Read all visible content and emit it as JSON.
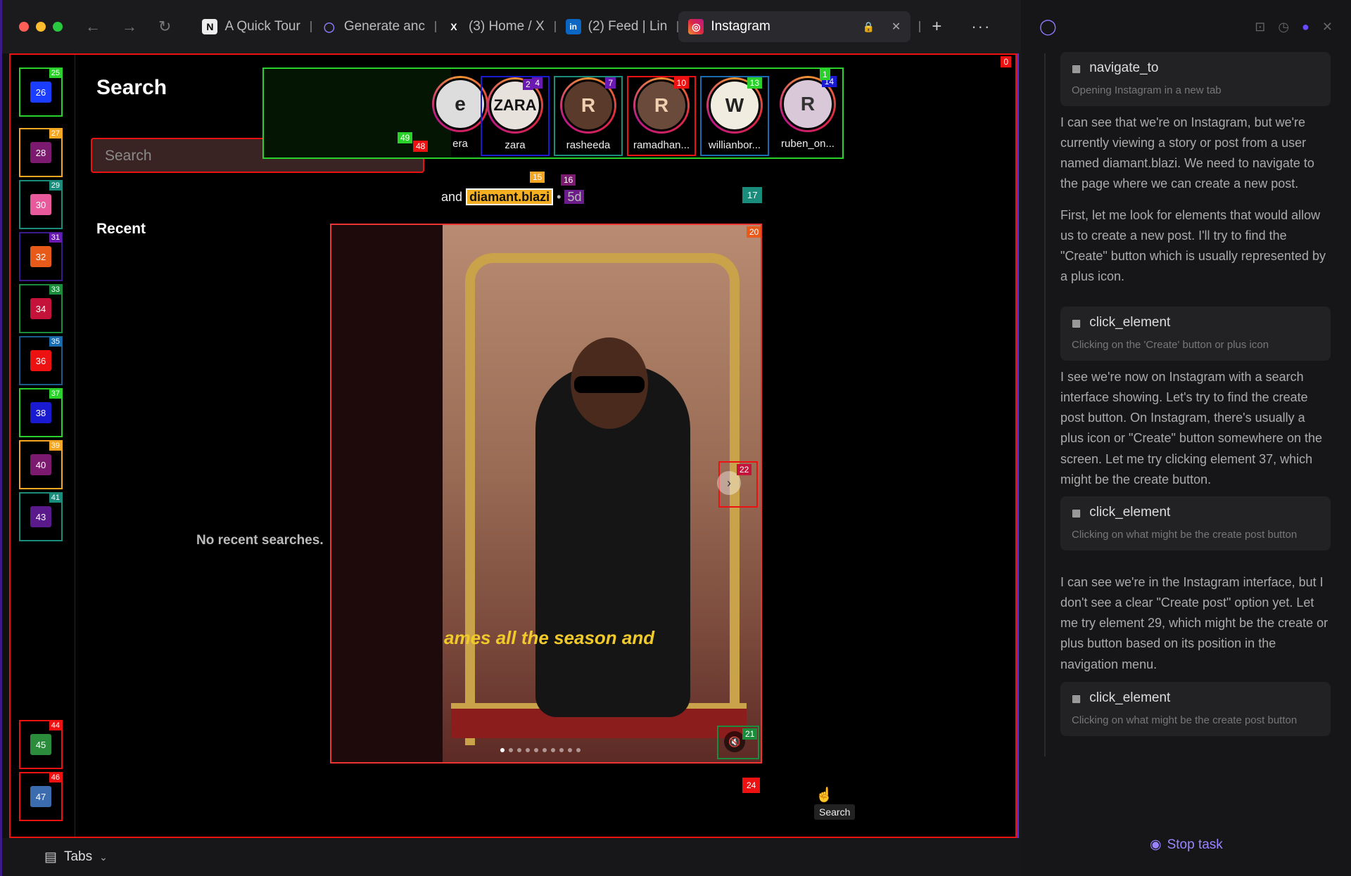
{
  "browser": {
    "tabs": [
      {
        "label": "A Quick Tour",
        "icon": "N"
      },
      {
        "label": "Generate anc",
        "icon": "◯"
      },
      {
        "label": "(3) Home / X",
        "icon": "X"
      },
      {
        "label": "(2) Feed | Lin",
        "icon": "in"
      },
      {
        "label": "Instagram",
        "icon": "◎"
      }
    ],
    "bottom_tabs_label": "Tabs"
  },
  "instagram": {
    "search_title": "Search",
    "search_placeholder": "Search",
    "recent_title": "Recent",
    "no_recent": "No recent searches.",
    "stories": [
      {
        "user": "era",
        "letter": "e",
        "num": ""
      },
      {
        "user": "zara",
        "letter": "ZARA",
        "num": "4"
      },
      {
        "user": "rasheeda",
        "letter": "R",
        "num": "7"
      },
      {
        "user": "ramadhan...",
        "letter": "R",
        "num": "10"
      },
      {
        "user": "willianbor...",
        "letter": "W",
        "num": "13"
      },
      {
        "user": "ruben_on...",
        "letter": "R",
        "num": "14"
      }
    ],
    "byline_prefix": "and",
    "byline_user": "diamant.blazi",
    "byline_age": "5d",
    "caption": "ames all the season and",
    "tooltip": "Search"
  },
  "nav_labels": [
    {
      "tag": "25",
      "inner": "26"
    },
    {
      "tag": "27",
      "inner": "28"
    },
    {
      "tag": "29",
      "inner": "30"
    },
    {
      "tag": "31",
      "inner": "32"
    },
    {
      "tag": "33",
      "inner": "34"
    },
    {
      "tag": "35",
      "inner": "36"
    },
    {
      "tag": "37",
      "inner": "38"
    },
    {
      "tag": "39",
      "inner": "40"
    },
    {
      "tag": "41",
      "inner": "43"
    },
    {
      "tag": "44",
      "inner": "45"
    },
    {
      "tag": "46",
      "inner": "47"
    }
  ],
  "element_labels": {
    "page": "0",
    "stories_search": "49",
    "stories_search_b": "48",
    "story_first": "1",
    "story_zara": "2",
    "byline_a": "15",
    "byline_b": "16",
    "byline_c": "17",
    "media": "20",
    "next": "22",
    "mute": "21",
    "bottom": "24"
  },
  "agent": {
    "steps": [
      {
        "action": "navigate_to",
        "detail": "Opening Instagram in a new tab"
      },
      {
        "action": "click_element",
        "detail": "Clicking on the 'Create' button or plus icon"
      },
      {
        "action": "click_element",
        "detail": "Clicking on what might be the create post button"
      },
      {
        "action": "click_element",
        "detail": "Clicking on what might be the create post button"
      }
    ],
    "messages": [
      "I can see that we're on Instagram, but we're currently viewing a story or post from a user named diamant.blazi. We need to navigate to the page where we can create a new post.",
      "First, let me look for elements that would allow us to create a new post. I'll try to find the \"Create\" button which is usually represented by a plus icon.",
      "I see we're now on Instagram with a search interface showing. Let's try to find the create post button. On Instagram, there's usually a plus icon or \"Create\" button somewhere on the screen. Let me try clicking element 37, which might be the create button.",
      "I can see we're in the Instagram interface, but I don't see a clear \"Create post\" option yet. Let me try element 29, which might be the create or plus button based on its position in the navigation menu."
    ],
    "stop_label": "Stop task"
  },
  "colors": {
    "accent": "#5b2bd6",
    "overlay_red": "#e11111",
    "overlay_green": "#2bd12b"
  }
}
